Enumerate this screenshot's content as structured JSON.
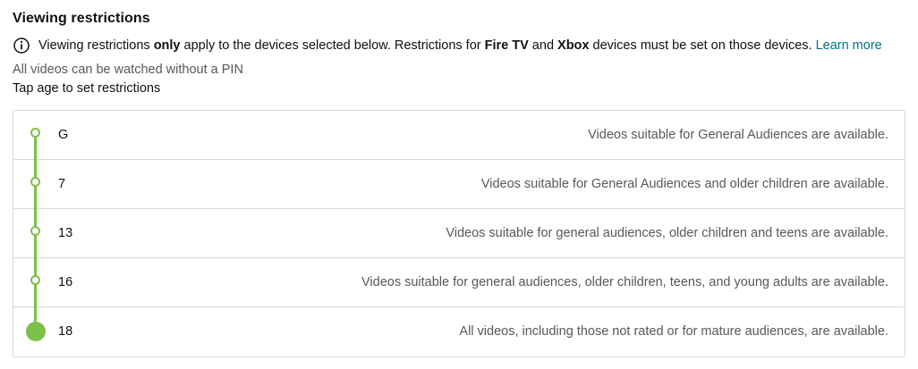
{
  "page": {
    "title": "Viewing restrictions",
    "notice": {
      "part1": "Viewing restrictions ",
      "bold1": "only",
      "part2": " apply to the devices selected below. Restrictions for ",
      "bold2": "Fire TV",
      "part3": " and ",
      "bold3": "Xbox",
      "part4": " devices must be set on those devices. ",
      "link": "Learn more"
    },
    "pin_status": "All videos can be watched without a PIN",
    "tap_hint": "Tap age to set restrictions"
  },
  "ratings": [
    {
      "age": "G",
      "description": "Videos suitable for General Audiences are available."
    },
    {
      "age": "7",
      "description": "Videos suitable for General Audiences and older children are available."
    },
    {
      "age": "13",
      "description": "Videos suitable for general audiences, older children and teens are available."
    },
    {
      "age": "16",
      "description": "Videos suitable for general audiences, older children, teens, and young adults are available."
    },
    {
      "age": "18",
      "description": "All videos, including those not rated or for mature audiences, are available."
    }
  ],
  "selected_age": "18",
  "colors": {
    "accent": "#7bc04a",
    "link": "#007185",
    "border": "#d5d9d9",
    "muted_text": "#565959"
  },
  "icons": {
    "notice": "info-circle-icon"
  }
}
